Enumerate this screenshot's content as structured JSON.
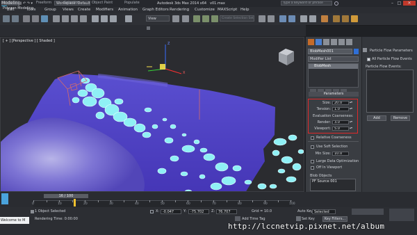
{
  "title_bar": {
    "workspace": "Workspace: Default",
    "window_title": "Autodesk 3ds Max 2014 x64",
    "file_name": "v01.max",
    "search_placeholder": "Type a keyword or phrase"
  },
  "menu": {
    "items": [
      "Edit",
      "Tools",
      "Group",
      "Views",
      "Create",
      "Modifiers",
      "Animation",
      "Graph Editors",
      "Rendering",
      "Customize",
      "MAXScript",
      "Help"
    ]
  },
  "toolbar": {
    "view_dropdown": "View",
    "selection_set": "Create Selection Set"
  },
  "ribbon": {
    "tabs": [
      "Modeling",
      "Freeform",
      "Selection",
      "Object Paint",
      "Populate"
    ],
    "active_panel": "Polygon Modeling"
  },
  "viewport": {
    "label": "[ + ] [Perspective ] [ Shaded ]",
    "gizmo_axis_x": "X",
    "gizmo_axis_z": "Z"
  },
  "command_panel": {
    "object_name": "BlobMesh001",
    "modifier_list": "Modifier List",
    "stack_item": "BlobMesh",
    "parameters_title": "Parameters",
    "params": [
      {
        "label": "Size:",
        "value": "20.0"
      },
      {
        "label": "Tension:",
        "value": "1.0"
      },
      {
        "label": "Render:",
        "value": "3.0"
      },
      {
        "label": "Viewport:",
        "value": "5.0"
      }
    ],
    "coarseness_label": "Evaluation Coarseness:",
    "relative_coarseness": "Relative Coarseness",
    "use_soft_selection": "Use Soft Selection",
    "min_size_label": "Min Size:",
    "min_size_value": "10.0",
    "large_data_opt": "Large Data Optimization",
    "off_in_viewport": "Off In Viewport",
    "blob_objects_title": "Blob Objects",
    "blob_objects": [
      "PF Source 001"
    ]
  },
  "pf_panel": {
    "title": "Particle Flow Parameters",
    "all_events": "All Particle Flow Events",
    "events_label": "Particle Flow Events:",
    "add_button": "Add",
    "remove_button": "Remove"
  },
  "timeline": {
    "frame_counter": "16 / 100",
    "ticks": [
      "0",
      "5",
      "10",
      "15",
      "20",
      "25",
      "30",
      "35",
      "40",
      "45",
      "50",
      "55",
      "60",
      "65",
      "70",
      "75",
      "80",
      "85",
      "90",
      "95",
      "100"
    ],
    "current_frame": 16
  },
  "status": {
    "welcome": "Welcome to M",
    "selection": "1 Object Selected",
    "rendering_time": "Rendering Time: 0:00:00",
    "x_label": "X:",
    "x_value": "-0.047",
    "y_label": "Y:",
    "y_value": "-75.702",
    "z_label": "Z:",
    "z_value": "76.707",
    "grid": "Grid = 10.0",
    "add_time_tag": "Add Time Tag",
    "auto_key": "Auto Key",
    "selected_dropdown": "Selected",
    "set_key": "Set Key",
    "key_filters": "Key Filters...",
    "watermark": "http://lccnetvip.pixnet.net/album"
  }
}
